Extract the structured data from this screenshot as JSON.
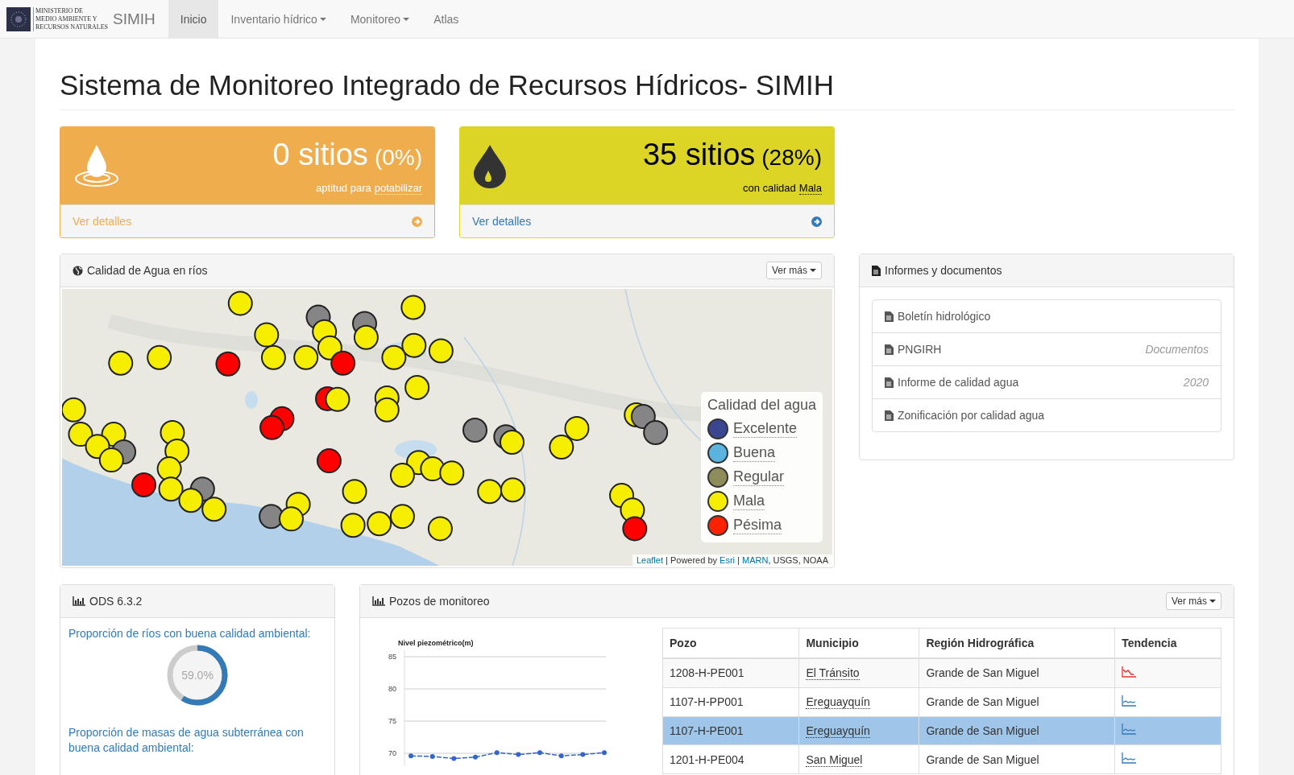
{
  "navbar": {
    "logo_lines": [
      "MINISTERIO DE",
      "MEDIO AMBIENTE Y",
      "RECURSOS NATURALES"
    ],
    "brand": "SIMIH",
    "items": [
      {
        "label": "Inicio",
        "dropdown": false,
        "selected": true
      },
      {
        "label": "Inventario hídrico",
        "dropdown": true,
        "selected": false
      },
      {
        "label": "Monitoreo",
        "dropdown": true,
        "selected": false
      },
      {
        "label": "Atlas",
        "dropdown": false,
        "selected": false
      }
    ]
  },
  "page_title": "Sistema de Monitoreo Integrado de Recursos Hídricos- SIMIH",
  "stat_cards": [
    {
      "kind": "potable",
      "count": "0 sitios",
      "percent": "(0%)",
      "caption": "aptitud para",
      "term": "potabilizar",
      "link": "Ver detalles"
    },
    {
      "kind": "mala",
      "count": "35 sitios",
      "percent": "(28%)",
      "caption": "con calidad",
      "term": "Mala",
      "link": "Ver detalles"
    }
  ],
  "map_panel": {
    "title": "Calidad de Agua en ríos",
    "menu_button": "Ver más",
    "markers": [
      {
        "color": "#f5ee00"
      },
      {
        "color": "#f5ee00"
      },
      {
        "color": "#858585"
      },
      {
        "color": "#f5ee00"
      },
      {
        "color": "#858585"
      },
      {
        "color": "#f5ee00"
      },
      {
        "color": "#f5ee00"
      },
      {
        "color": "#f5ee00"
      },
      {
        "color": "#f5ee00"
      },
      {
        "color": "#f5ee00"
      },
      {
        "color": "#ff0000"
      },
      {
        "color": "#ff0000"
      },
      {
        "color": "#f5ee00"
      },
      {
        "color": "#f5ee00"
      },
      {
        "color": "#f5ee00"
      },
      {
        "color": "#f5ee00"
      },
      {
        "color": "#f5ee00"
      },
      {
        "color": "#f5ee00"
      },
      {
        "color": "#f5ee00"
      },
      {
        "color": "#f5ee00"
      },
      {
        "color": "#ff0000"
      },
      {
        "color": "#f5ee00"
      },
      {
        "color": "#ff0000"
      },
      {
        "color": "#ff0000"
      },
      {
        "color": "#f5ee00"
      },
      {
        "color": "#f5ee00"
      },
      {
        "color": "#f5ee00"
      },
      {
        "color": "#858585"
      },
      {
        "color": "#f5ee00"
      },
      {
        "color": "#f5ee00"
      },
      {
        "color": "#f5ee00"
      },
      {
        "color": "#f5ee00"
      },
      {
        "color": "#f5ee00"
      },
      {
        "color": "#ff0000"
      },
      {
        "color": "#858585"
      },
      {
        "color": "#f5ee00"
      },
      {
        "color": "#f5ee00"
      },
      {
        "color": "#f5ee00"
      },
      {
        "color": "#ff0000"
      },
      {
        "color": "#f5ee00"
      },
      {
        "color": "#f5ee00"
      },
      {
        "color": "#858585"
      },
      {
        "color": "#f5ee00"
      },
      {
        "color": "#f5ee00"
      },
      {
        "color": "#f5ee00"
      },
      {
        "color": "#f5ee00"
      },
      {
        "color": "#f5ee00"
      },
      {
        "color": "#858585"
      },
      {
        "color": "#858585"
      },
      {
        "color": "#f5ee00"
      },
      {
        "color": "#f5ee00"
      },
      {
        "color": "#f5ee00"
      },
      {
        "color": "#f5ee00"
      },
      {
        "color": "#f5ee00"
      },
      {
        "color": "#f5ee00"
      },
      {
        "color": "#f5ee00"
      },
      {
        "color": "#f5ee00"
      },
      {
        "color": "#f5ee00"
      },
      {
        "color": "#f5ee00"
      },
      {
        "color": "#858585"
      },
      {
        "color": "#858585"
      },
      {
        "color": "#f5ee00"
      },
      {
        "color": "#f5ee00"
      },
      {
        "color": "#ff0000"
      }
    ],
    "legend": {
      "title": "Calidad del agua",
      "items": [
        {
          "label": "Excelente",
          "color": "#3b4690"
        },
        {
          "label": "Buena",
          "color": "#5ab4de"
        },
        {
          "label": "Regular",
          "color": "#8f8c5c"
        },
        {
          "label": "Mala",
          "color": "#f5ee00"
        },
        {
          "label": "Pésima",
          "color": "#ff2200"
        }
      ]
    },
    "attribution": [
      {
        "text": "Leaflet",
        "link": true
      },
      {
        "text": " | Powered by ",
        "link": false
      },
      {
        "text": "Esri",
        "link": true
      },
      {
        "text": " | ",
        "link": false
      },
      {
        "text": "MARN",
        "link": true
      },
      {
        "text": ", USGS, NOAA",
        "link": false
      }
    ]
  },
  "documents_panel": {
    "title": "Informes y documentos",
    "items": [
      {
        "label": "Boletín hidrológico"
      },
      {
        "label": "PNGIRH",
        "note": "Documentos"
      },
      {
        "label": "Informe de calidad agua",
        "note": "2020"
      },
      {
        "label": "Zonificación por calidad agua"
      }
    ]
  },
  "ods_panel": {
    "title": "ODS 6.3.2",
    "indicators": [
      {
        "label": "Proporción de ríos con buena calidad ambiental:",
        "value": "59.0%",
        "level": 0.59
      },
      {
        "label": "Proporción de masas de agua subterránea con buena calidad ambiental:"
      }
    ]
  },
  "wells_panel": {
    "title": "Pozos de monitoreo",
    "menu_button": "Ver más",
    "chart_data": {
      "type": "line",
      "title": "Nivel piezométrico(m)",
      "yticks": [
        70,
        75,
        80,
        85
      ],
      "ylim": [
        68,
        86
      ],
      "grid": true,
      "series": [
        {
          "color": "#3366cc",
          "line_style": "dashed",
          "marker": "circle",
          "values": [
            69.6,
            69.5,
            69.2,
            69.4,
            70.1,
            69.8,
            70.1,
            69.6,
            69.8,
            70.1
          ]
        }
      ]
    },
    "table": {
      "columns": [
        "Pozo",
        "Municipio",
        "Región Hidrográfica",
        "Tendencia"
      ],
      "rows": [
        {
          "pozo": "1208-H-PE001",
          "municipio": "El Tránsito",
          "region": "Grande de San Miguel",
          "kind": "down",
          "selected": false
        },
        {
          "pozo": "1107-H-PP001",
          "municipio": "Ereguayquín",
          "region": "Grande de San Miguel",
          "kind": "flat",
          "selected": false
        },
        {
          "pozo": "1107-H-PE001",
          "municipio": "Ereguayquín",
          "region": "Grande de San Miguel",
          "kind": "flat",
          "selected": true
        },
        {
          "pozo": "1201-H-PE004",
          "municipio": "San Miguel",
          "region": "Grande de San Miguel",
          "kind": "flat",
          "selected": false
        }
      ]
    }
  }
}
